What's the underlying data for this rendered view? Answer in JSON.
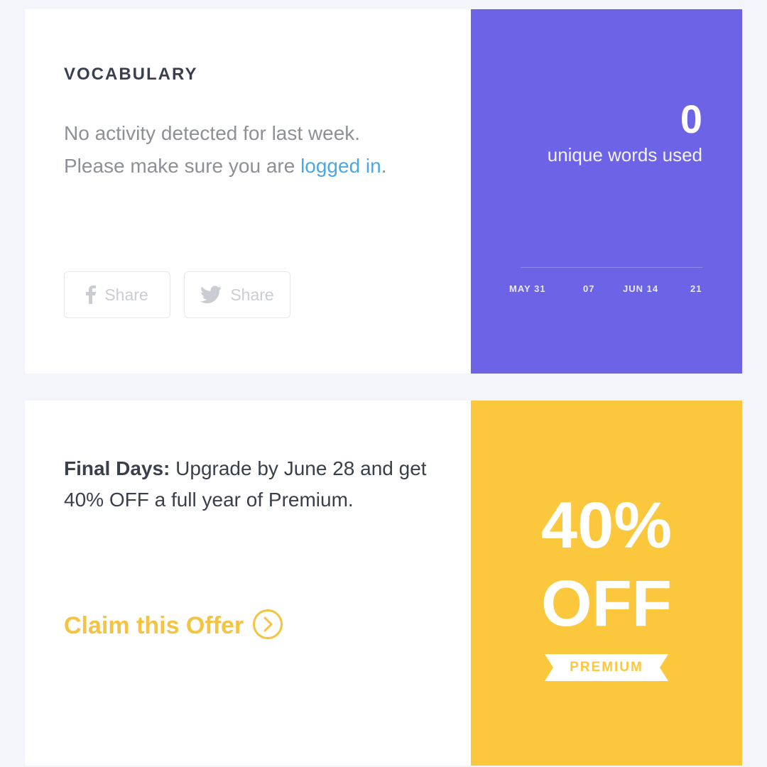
{
  "vocabulary": {
    "heading": "VOCABULARY",
    "message_line1": "No activity detected for last week.",
    "message_line2_prefix": "Please make sure you are ",
    "login_link": "logged in",
    "message_line2_suffix": ".",
    "share_facebook": "Share",
    "share_twitter": "Share",
    "stat_value": "0",
    "stat_label": "unique words used",
    "axis_ticks": [
      "MAY 31",
      "07",
      "JUN 14",
      "21"
    ],
    "panel_color": "#6c63e6",
    "link_color": "#4aa8e8"
  },
  "offer": {
    "lead_bold": "Final Days:",
    "lead_text": " Upgrade by June 28 and get 40% OFF a full year of Premium.",
    "cta": "Claim this Offer",
    "badge_line1": "40%",
    "badge_line2": "OFF",
    "ribbon": "PREMIUM",
    "panel_color": "#fbc73d"
  },
  "icons": {
    "facebook": "facebook-icon",
    "twitter": "twitter-icon",
    "cta_arrow": "chevron-right-circle-icon"
  }
}
